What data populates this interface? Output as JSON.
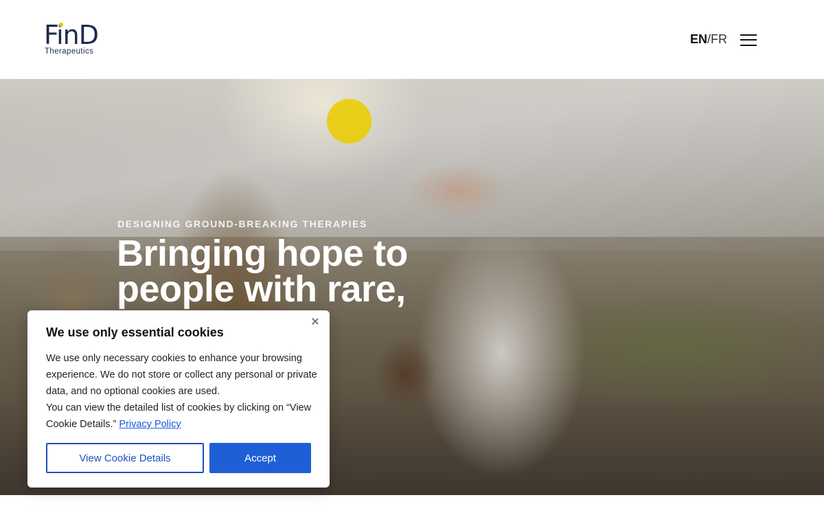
{
  "header": {
    "logo": {
      "wordmark": "FinD",
      "subtitle": "Therapeutics"
    },
    "language": {
      "active": "EN",
      "separator": "/",
      "other": "FR"
    },
    "menu_icon": "hamburger-menu-icon"
  },
  "hero": {
    "eyebrow": "DESIGNING GROUND-BREAKING THERAPIES",
    "headline": "Bringing hope to people with rare, devastating",
    "accent_color": "#e8c900"
  },
  "cookie_banner": {
    "title": "We use only essential cookies",
    "paragraph_1": "We use only necessary cookies to enhance your browsing experience. We do not store or collect any personal or private data, and no optional cookies are used.",
    "paragraph_2": "You can view the detailed list of cookies by clicking on “View Cookie Details.”",
    "privacy_link": "Privacy Policy",
    "details_button": "View Cookie Details",
    "accept_button": "Accept",
    "close_icon": "close-icon",
    "primary_color": "#1f5fd6"
  }
}
